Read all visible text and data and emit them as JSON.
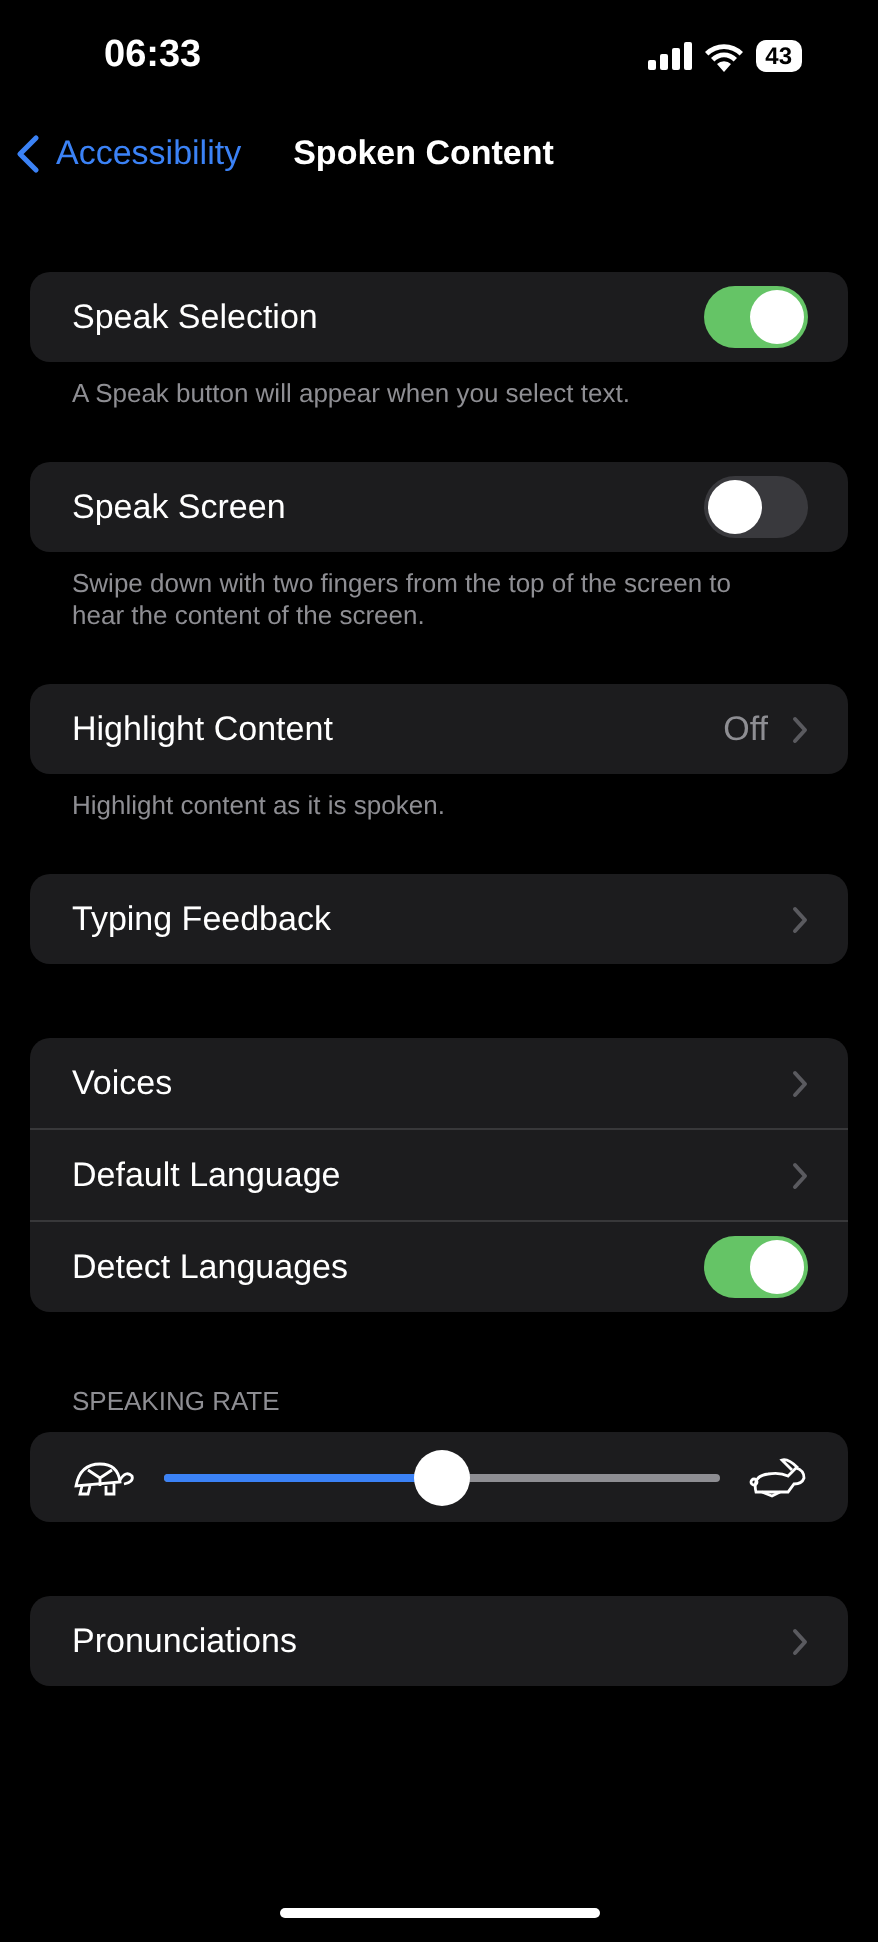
{
  "status_bar": {
    "time": "06:33",
    "battery": "43"
  },
  "nav": {
    "back": "Accessibility",
    "title": "Spoken Content"
  },
  "groups": [
    {
      "rows": [
        {
          "kind": "toggle",
          "label": "Speak Selection",
          "on": true
        }
      ],
      "footer": "A Speak button will appear when you select text."
    },
    {
      "rows": [
        {
          "kind": "toggle",
          "label": "Speak Screen",
          "on": false
        }
      ],
      "footer": "Swipe down with two fingers from the top of the screen to hear the content of the screen."
    },
    {
      "rows": [
        {
          "kind": "link",
          "label": "Highlight Content",
          "value": "Off"
        }
      ],
      "footer": "Highlight content as it is spoken."
    },
    {
      "rows": [
        {
          "kind": "link",
          "label": "Typing Feedback"
        }
      ]
    },
    {
      "rows": [
        {
          "kind": "link",
          "label": "Voices"
        },
        {
          "kind": "link",
          "label": "Default Language"
        },
        {
          "kind": "toggle",
          "label": "Detect Languages",
          "on": true
        }
      ]
    },
    {
      "header": "SPEAKING RATE",
      "rows": [
        {
          "kind": "slider",
          "level": 0.5
        }
      ]
    },
    {
      "rows": [
        {
          "kind": "link",
          "label": "Pronunciations"
        }
      ]
    }
  ]
}
